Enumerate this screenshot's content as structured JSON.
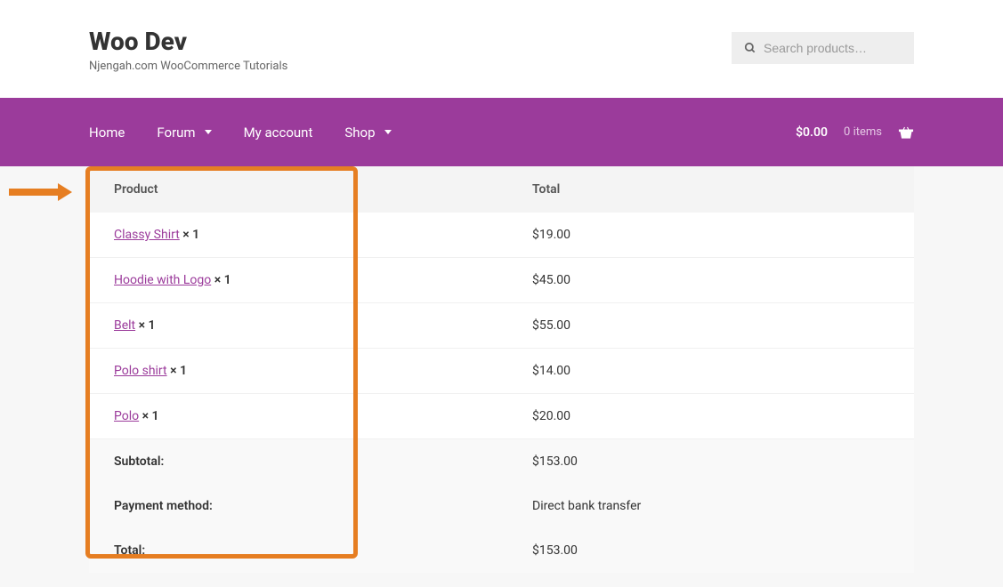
{
  "site": {
    "title": "Woo Dev",
    "tagline": "Njengah.com WooCommerce Tutorials"
  },
  "search": {
    "placeholder": "Search products…"
  },
  "nav": {
    "items": [
      {
        "label": "Home",
        "dropdown": false
      },
      {
        "label": "Forum",
        "dropdown": true
      },
      {
        "label": "My account",
        "dropdown": false
      },
      {
        "label": "Shop",
        "dropdown": true
      }
    ],
    "cart": {
      "price": "$0.00",
      "count": "0 items"
    }
  },
  "order": {
    "headers": {
      "product": "Product",
      "total": "Total"
    },
    "items": [
      {
        "name": "Classy Shirt",
        "qty": " × 1",
        "price": "$19.00"
      },
      {
        "name": "Hoodie with Logo",
        "qty": " × 1",
        "price": "$45.00"
      },
      {
        "name": "Belt",
        "qty": " × 1",
        "price": "$55.00"
      },
      {
        "name": "Polo shirt",
        "qty": " × 1",
        "price": "$14.00"
      },
      {
        "name": "Polo",
        "qty": " × 1",
        "price": "$20.00"
      }
    ],
    "summary": [
      {
        "label": "Subtotal:",
        "value": "$153.00"
      },
      {
        "label": "Payment method:",
        "value": "Direct bank transfer"
      },
      {
        "label": "Total:",
        "value": "$153.00"
      }
    ]
  }
}
